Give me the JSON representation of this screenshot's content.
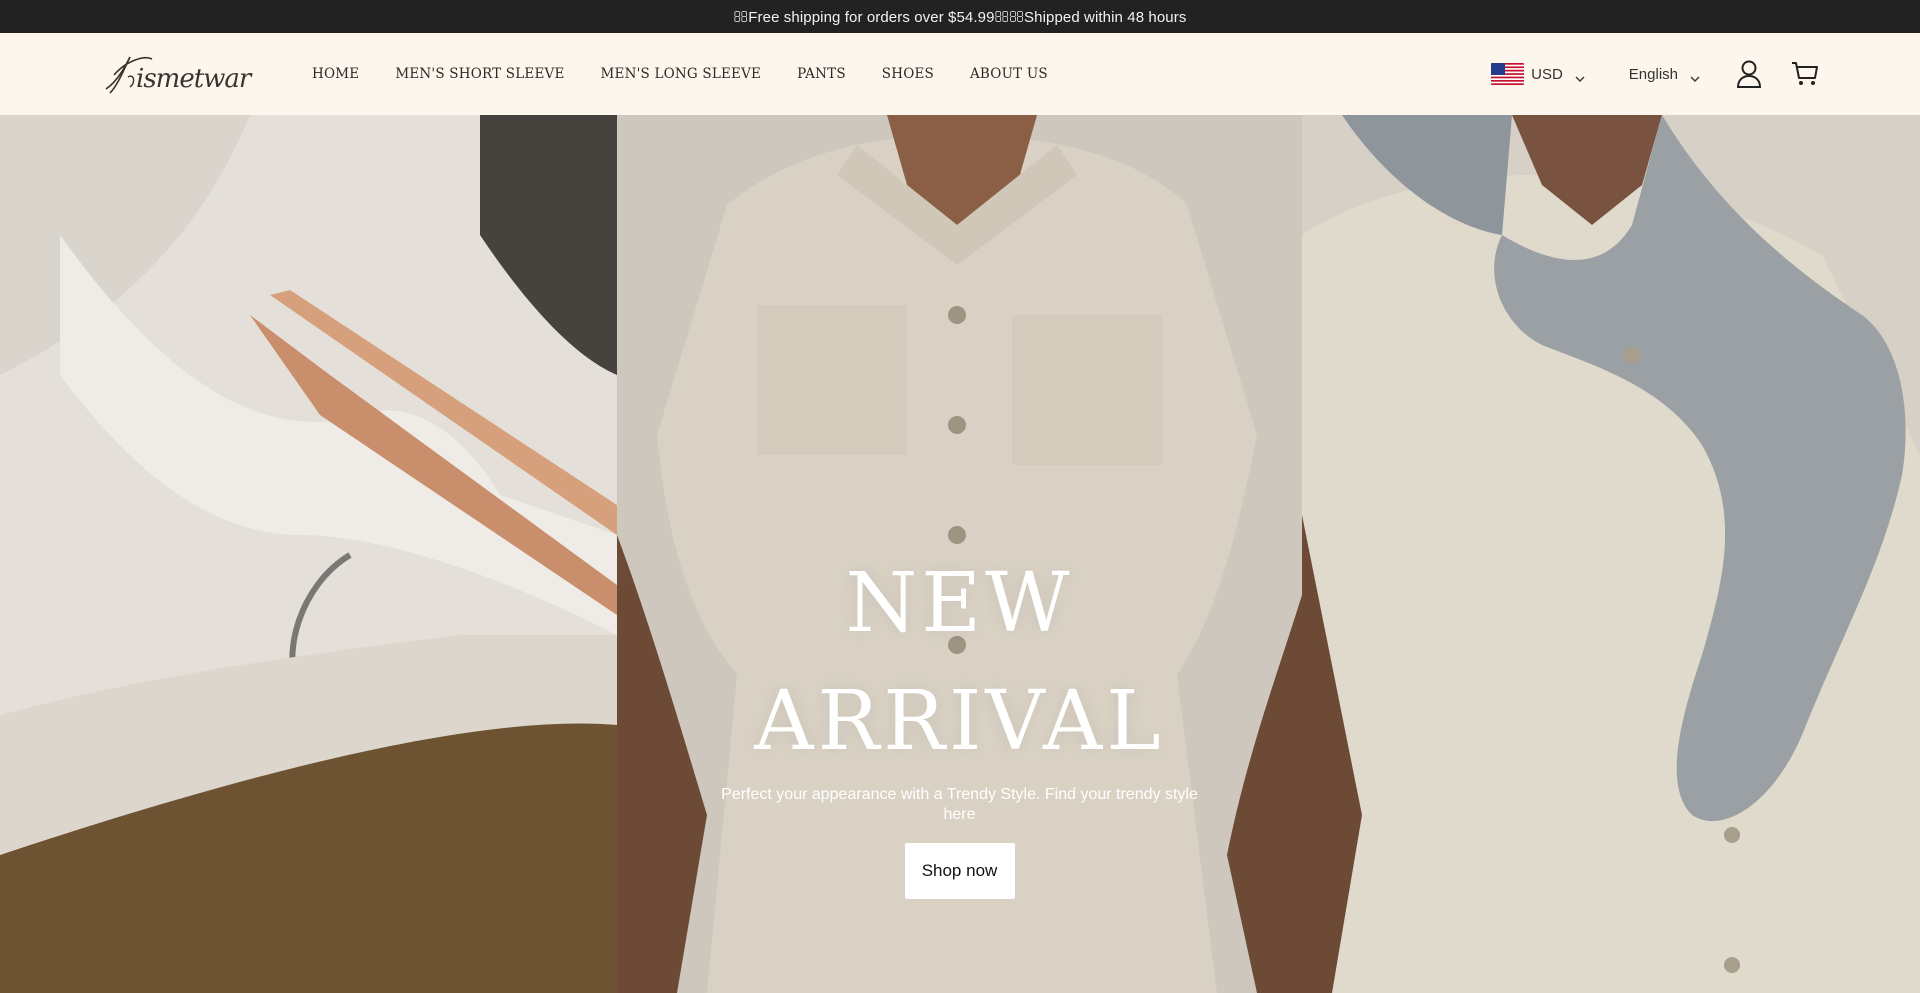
{
  "announcement": {
    "text": "Free shipping for orders over $54.99Shipped within 48 hours"
  },
  "brand": {
    "logo_text": "Kismetwar"
  },
  "nav": {
    "items": [
      {
        "label": "HOME"
      },
      {
        "label": "MEN'S SHORT SLEEVE"
      },
      {
        "label": "MEN'S LONG SLEEVE"
      },
      {
        "label": "PANTS"
      },
      {
        "label": "SHOES"
      },
      {
        "label": "ABOUT US"
      }
    ]
  },
  "tools": {
    "currency": {
      "label": "USD",
      "flag_icon": "us-flag-icon"
    },
    "language": {
      "label": "English"
    },
    "account_icon": "user-icon",
    "cart_icon": "cart-icon"
  },
  "hero": {
    "title_line1": "NEW",
    "title_line2": "ARRIVAL",
    "subtitle": "Perfect your appearance with a Trendy Style. Find your trendy style here",
    "cta_label": "Shop now"
  },
  "colors": {
    "announcement_bg": "#222222",
    "header_bg": "#fdf6ec",
    "cta_bg": "#ffffff"
  }
}
